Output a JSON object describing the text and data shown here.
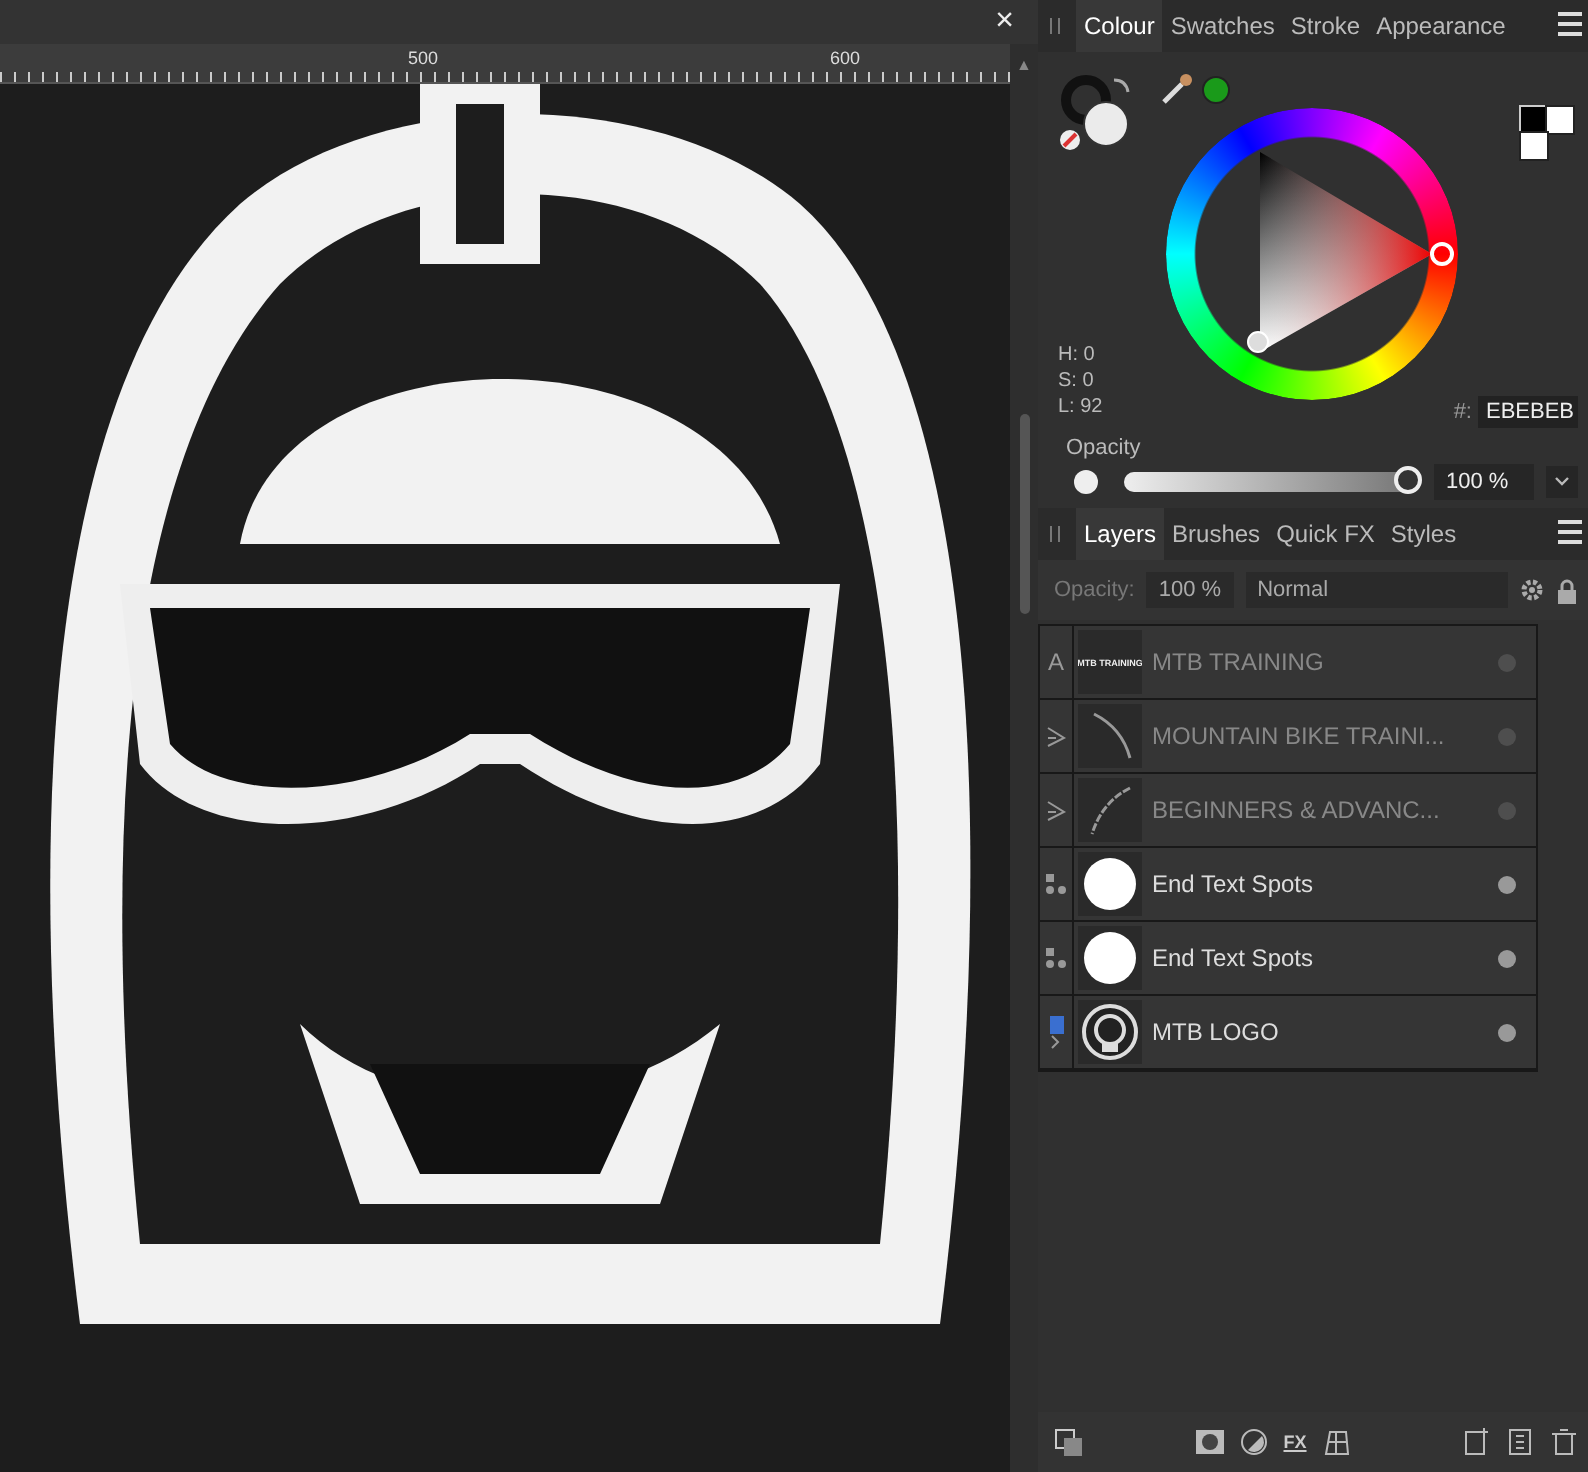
{
  "canvas": {
    "close": "×",
    "ruler_labels": [
      "500",
      "600"
    ],
    "scroll_up": "▲"
  },
  "colour_panel": {
    "tabs": [
      {
        "label": "Colour",
        "selected": true
      },
      {
        "label": "Swatches",
        "selected": false
      },
      {
        "label": "Stroke",
        "selected": false
      },
      {
        "label": "Appearance",
        "selected": false
      }
    ],
    "hsl": [
      "H: 0",
      "S: 0",
      "L: 92"
    ],
    "hex_label": "#:",
    "hex": "EBEBEB",
    "opacity_label": "Opacity",
    "opacity": {
      "level": 1
    },
    "opacity_value": "100 %"
  },
  "layers_panel": {
    "tabs": [
      {
        "label": "Layers",
        "selected": true
      },
      {
        "label": "Brushes",
        "selected": false
      },
      {
        "label": "Quick FX",
        "selected": false
      },
      {
        "label": "Styles",
        "selected": false
      }
    ],
    "opacity_label": "Opacity:",
    "opacity_value": "100 %",
    "blend_mode": "Normal",
    "layers": [
      {
        "kind": "text",
        "type_glyph": "A",
        "thumb_text": "MTB TRAINING",
        "name": "MTB TRAINING",
        "visible": false
      },
      {
        "kind": "path",
        "name": "MOUNTAIN BIKE TRAINI...",
        "visible": false
      },
      {
        "kind": "path2",
        "name": "BEGINNERS  &  ADVANC...",
        "visible": false
      },
      {
        "kind": "shape",
        "name": "End Text Spots",
        "visible": true
      },
      {
        "kind": "shape",
        "name": "End Text Spots",
        "visible": true
      },
      {
        "kind": "group",
        "name": "MTB LOGO",
        "visible": true,
        "expanded": false
      }
    ],
    "fx_label": "FX"
  }
}
